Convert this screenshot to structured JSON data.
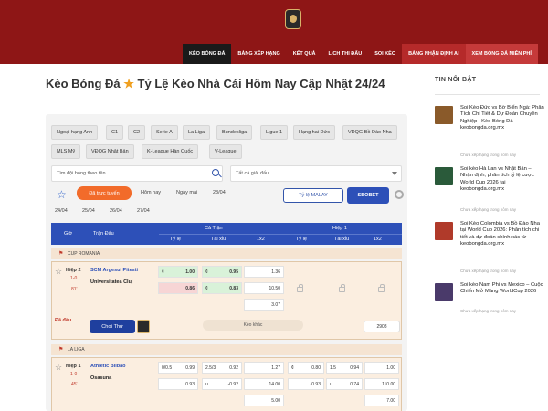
{
  "header": {
    "nav": [
      "Kèo bóng đá",
      "Bảng xếp hạng",
      "Kết quả",
      "Lịch thi đấu",
      "Soi kèo",
      "Bảng nhận định AI",
      "Xem bóng đá miễn phí"
    ]
  },
  "main": {
    "title_prefix": "Kèo Bóng Đá",
    "title_star": "★",
    "title_suffix": "Tỷ Lệ Kèo Nhà Cái Hôm Nay Cập Nhật 24/24",
    "leagues": [
      "Ngoại hạng Anh",
      "C1",
      "C2",
      "Serie A",
      "La Liga",
      "Bundesliga",
      "Ligue 1",
      "Hạng hai Đức",
      "VĐQG Bồ Đào Nha",
      "MLS Mỹ",
      "VĐQG Nhật Bản",
      "K-League Hàn Quốc",
      "V-League"
    ],
    "search_placeholder": "Tìm đội bóng theo tên",
    "filter_placeholder": "Tất cả giải đấu",
    "live_label": "Đã trực tuyến",
    "today": "Hôm nay",
    "tomorrow": "Ngày mai",
    "dates": [
      "23/04",
      "24/04",
      "25/04",
      "26/04",
      "27/04"
    ],
    "odds_type": "Tỷ lệ MALAY",
    "bookmaker": "SBOBET",
    "table": {
      "col_time": "Giờ",
      "col_match": "Trận Đấu",
      "full_time": "Cả Trận",
      "first_half": "Hiệp 1",
      "sub_cols": [
        "Tỷ lệ",
        "Tài xỉu",
        "1x2",
        "Tỷ lệ",
        "Tài xỉu",
        "1x2"
      ]
    },
    "match1": {
      "league": "CUP ROMANIA",
      "period": "Hiệp 2",
      "score": "1-0",
      "minute": "81'",
      "home": "SCM Argesul Pitesti",
      "away": "Universitatea Cluj",
      "hcp_odds_home": "1.00",
      "hcp_odds_away": "0.86",
      "ou_odds_over": "0.95",
      "ou_odds_under": "0.83",
      "x12": [
        "1.36",
        "10.50",
        "3.07"
      ],
      "live_tag": "Đã đấu",
      "play_label": "Chơi Thử",
      "more_odds": "Kèo khác",
      "count": "2908"
    },
    "match2": {
      "league": "LA LIGA",
      "period": "Hiệp 1",
      "score": "1-0",
      "minute": "45'",
      "home": "Athletic Bilbao",
      "away": "Osasuna",
      "hcp_home": "0/0.5",
      "hcp_odds_home": "0.99",
      "hcp_odds_away": "0.93",
      "ou_line": "2.5/3",
      "ou_odds_over": "0.92",
      "ou_odds_under": "-0.92",
      "x12": [
        "1.27",
        "14.00",
        "5.00"
      ],
      "h1_hcp_odds_home": "0.80",
      "h1_hcp_odds_away": "-0.93",
      "h1_ou_line": "1.5",
      "h1_ou_odds_over": "0.94",
      "h1_ou_odds_under": "0.74",
      "h1_x12": [
        "1.00",
        "110.00",
        "7.00"
      ]
    }
  },
  "sidebar": {
    "title": "TIN NỔI BẬT",
    "items": [
      {
        "text": "Soi Kèo Đức vs Bờ Biển Ngà: Phân Tích Chi Tiết & Dự Đoán Chuyên Nghiệp | Kèo Bóng Đá – keobongda.org.mx",
        "meta": "Chưa xếp hạng trong hôm nay"
      },
      {
        "text": "Soi kèo Hà Lan vs Nhật Bản – Nhận định, phân tích tỷ lệ cược World Cup 2026 tại keobongda.org.mx",
        "meta": "Chưa xếp hạng trong hôm nay"
      },
      {
        "text": "Soi Kèo Colombia vs Bồ Đào Nha tại World Cup 2026: Phân tích chi tiết và dự đoán chính xác từ keobongda.org.mx",
        "meta": "Chưa xếp hạng trong hôm nay"
      },
      {
        "text": "Soi kèo Nam Phi vs Mexico – Cuộc Chiến Mở Màng WorldCup 2026",
        "meta": "Chưa xếp hạng trong hôm nay"
      }
    ],
    "thumb_colors": [
      "#8a5a2a",
      "#2a5a3a",
      "#b03a2a",
      "#4a3a6a"
    ]
  }
}
